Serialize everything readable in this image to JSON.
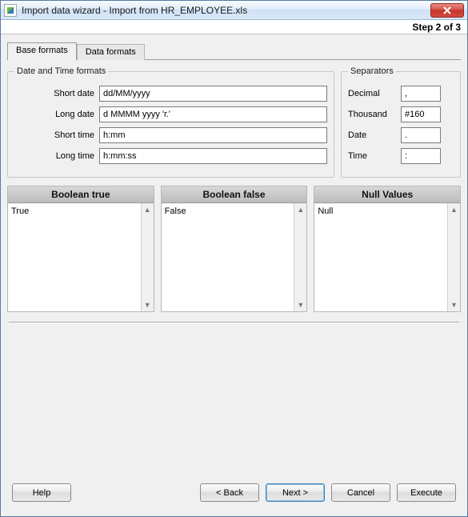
{
  "window": {
    "title": "Import data wizard - Import from HR_EMPLOYEE.xls",
    "step_label": "Step 2 of 3"
  },
  "tabs": {
    "base": "Base formats",
    "data": "Data formats"
  },
  "dt_group": {
    "legend": "Date and Time formats",
    "short_date": {
      "label": "Short date",
      "value": "dd/MM/yyyy"
    },
    "long_date": {
      "label": "Long date",
      "value": "d MMMM yyyy 'г.'"
    },
    "short_time": {
      "label": "Short time",
      "value": "h:mm"
    },
    "long_time": {
      "label": "Long time",
      "value": "h:mm:ss"
    }
  },
  "sep_group": {
    "legend": "Separators",
    "decimal": {
      "label": "Decimal",
      "value": ","
    },
    "thousand": {
      "label": "Thousand",
      "value": "#160"
    },
    "date": {
      "label": "Date",
      "value": "."
    },
    "time": {
      "label": "Time",
      "value": ":"
    }
  },
  "lists": {
    "bool_true": {
      "title": "Boolean true",
      "items": [
        "True"
      ]
    },
    "bool_false": {
      "title": "Boolean false",
      "items": [
        "False"
      ]
    },
    "null_vals": {
      "title": "Null Values",
      "items": [
        "Null"
      ]
    }
  },
  "buttons": {
    "help": "Help",
    "back": "< Back",
    "next": "Next >",
    "cancel": "Cancel",
    "execute": "Execute"
  }
}
